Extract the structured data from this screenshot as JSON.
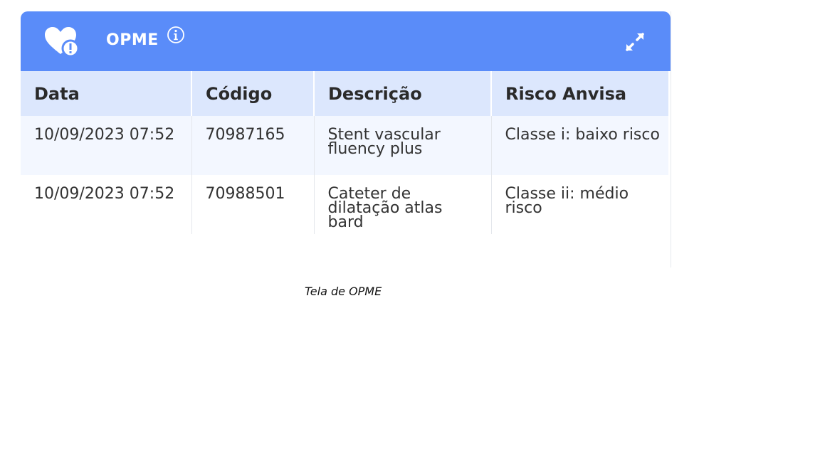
{
  "widget": {
    "title": "OPME",
    "icons": {
      "header": "heart-alert-icon",
      "info": "info-icon",
      "expand": "expand-icon"
    },
    "colors": {
      "header_bg": "#5a8cf9",
      "table_header_bg": "#dce7fd",
      "odd_row_bg": "#f3f7ff"
    },
    "columns": [
      "Data",
      "Código",
      "Descrição",
      "Risco Anvisa"
    ],
    "rows": [
      {
        "data": "10/09/2023 07:52",
        "codigo": "70987165",
        "descricao": "Stent vascular fluency plus",
        "risco": "Classe i: baixo risco"
      },
      {
        "data": "10/09/2023 07:52",
        "codigo": "70988501",
        "descricao": "Cateter de dilatação atlas bard",
        "risco": "Classe ii: médio risco"
      }
    ]
  },
  "caption": "Tela de OPME"
}
